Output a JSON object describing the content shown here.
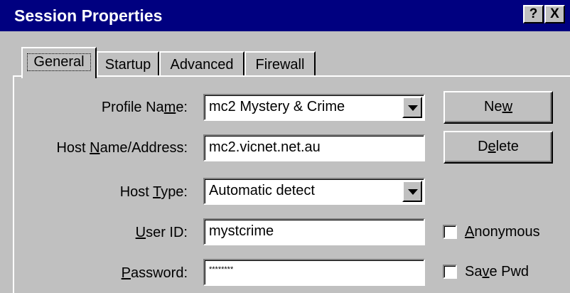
{
  "window": {
    "title": "Session Properties",
    "help_label": "?",
    "close_label": "X"
  },
  "tabs": [
    {
      "label": "General",
      "selected": true
    },
    {
      "label": "Startup",
      "selected": false
    },
    {
      "label": "Advanced",
      "selected": false
    },
    {
      "label": "Firewall",
      "selected": false
    }
  ],
  "form": {
    "profile_name": {
      "label_pre": "Profile Na",
      "label_ul": "m",
      "label_post": "e:",
      "value": "mc2 Mystery & Crime"
    },
    "host_name": {
      "label_pre": "Host ",
      "label_ul": "N",
      "label_post": "ame/Address:",
      "value": "mc2.vicnet.net.au"
    },
    "host_type": {
      "label_pre": "Host ",
      "label_ul": "T",
      "label_post": "ype:",
      "value": "Automatic detect"
    },
    "user_id": {
      "label_pre": "",
      "label_ul": "U",
      "label_post": "ser ID:",
      "value": "mystcrime"
    },
    "password": {
      "label_pre": "",
      "label_ul": "P",
      "label_post": "assword:",
      "value": "********"
    }
  },
  "buttons": {
    "new": {
      "pre": "Ne",
      "ul": "w",
      "post": ""
    },
    "delete": {
      "pre": "D",
      "ul": "e",
      "post": "lete"
    }
  },
  "checkboxes": {
    "anonymous": {
      "pre": "",
      "ul": "A",
      "post": "nonymous",
      "checked": false
    },
    "save_pwd": {
      "pre": "Sa",
      "ul": "v",
      "post": "e Pwd",
      "checked": false
    }
  },
  "colors": {
    "title_bar": "#000080",
    "face": "#c0c0c0"
  }
}
